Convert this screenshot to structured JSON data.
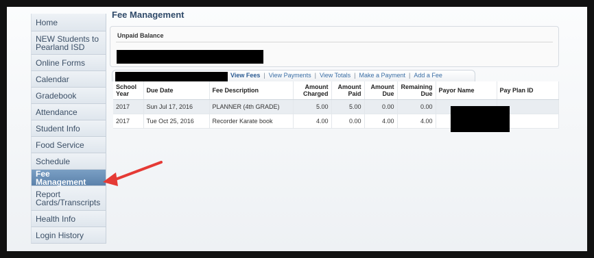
{
  "sidebar": {
    "items": [
      {
        "label": "Home"
      },
      {
        "label": "NEW Students to Pearland ISD"
      },
      {
        "label": "Online Forms"
      },
      {
        "label": "Calendar"
      },
      {
        "label": "Gradebook"
      },
      {
        "label": "Attendance"
      },
      {
        "label": "Student Info"
      },
      {
        "label": "Food Service"
      },
      {
        "label": "Schedule"
      },
      {
        "label": "Fee Management"
      },
      {
        "label": "Report Cards/Transcripts"
      },
      {
        "label": "Health Info"
      },
      {
        "label": "Login History"
      }
    ],
    "active_index": 9
  },
  "main": {
    "title": "Fee Management",
    "balance_label": "Unpaid Balance",
    "tabs": [
      {
        "label": "View Fees"
      },
      {
        "label": "View Payments"
      },
      {
        "label": "View Totals"
      },
      {
        "label": "Make a Payment"
      },
      {
        "label": "Add a Fee"
      }
    ],
    "tab_separator": "|",
    "table": {
      "headers": [
        "School Year",
        "Due Date",
        "Fee Description",
        "Amount Charged",
        "Amount Paid",
        "Amount Due",
        "Remaining Due",
        "Payor Name",
        "Pay Plan ID"
      ],
      "rows": [
        [
          "2017",
          "Sun Jul 17, 2016",
          "PLANNER (4th GRADE)",
          "5.00",
          "5.00",
          "0.00",
          "0.00",
          "",
          ""
        ],
        [
          "2017",
          "Tue Oct 25, 2016",
          "Recorder Karate book",
          "4.00",
          "0.00",
          "4.00",
          "4.00",
          "",
          ""
        ]
      ]
    }
  },
  "colors": {
    "active_nav": "#6a90b8",
    "link": "#3a6ea5",
    "annotation_arrow": "#e53a35",
    "redaction": "#000000"
  }
}
